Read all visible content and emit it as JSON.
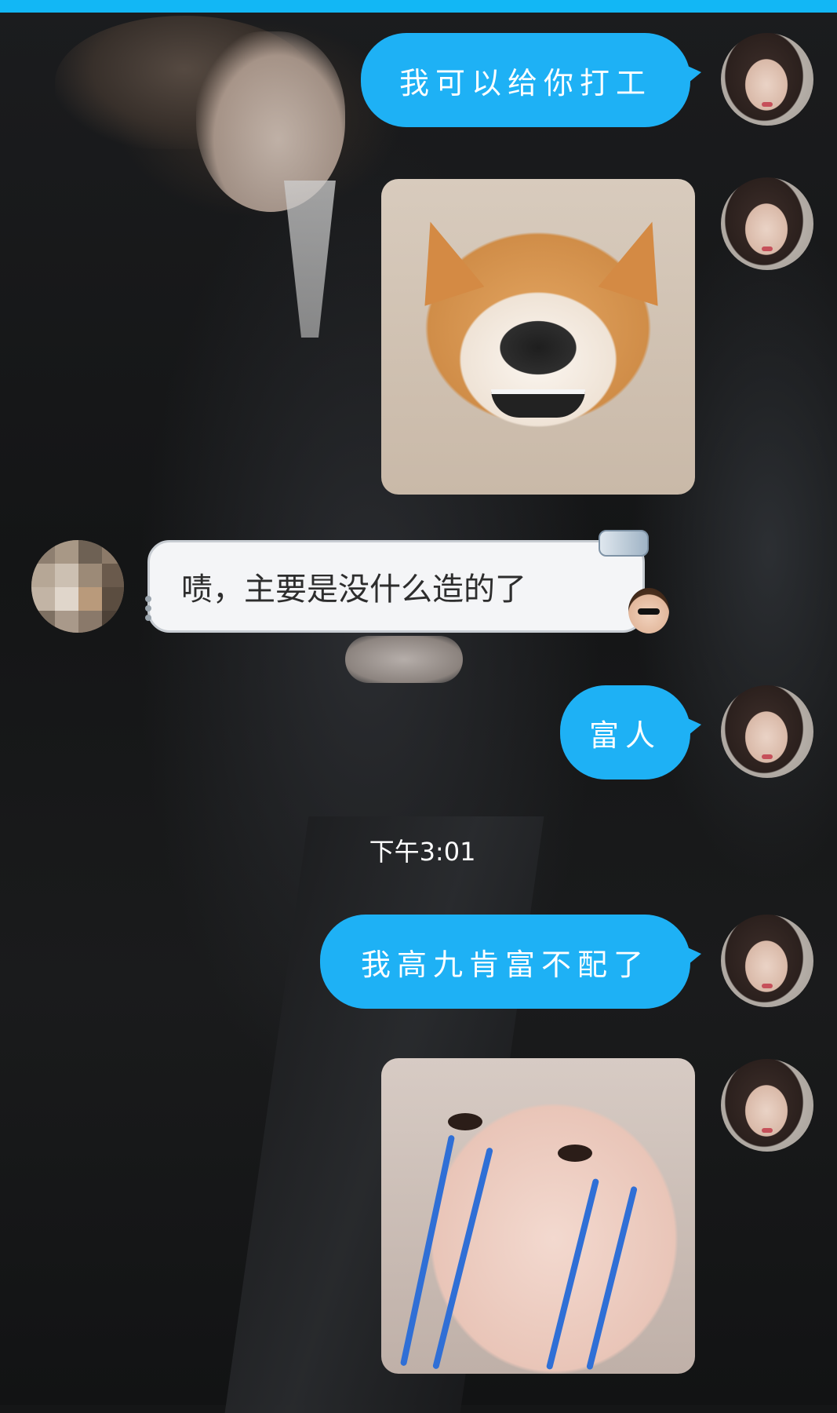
{
  "messages": [
    {
      "side": "right",
      "type": "text",
      "text": "我可以给你打工"
    },
    {
      "side": "right",
      "type": "sticker",
      "sticker": "smiling-shiba-dog"
    },
    {
      "side": "left",
      "type": "text",
      "text": "啧，主要是没什么造的了"
    },
    {
      "side": "right",
      "type": "text",
      "text": "富人"
    },
    {
      "side": "center",
      "type": "timestamp",
      "text": "下午3:01"
    },
    {
      "side": "right",
      "type": "text",
      "text": "我高九肯富不配了"
    },
    {
      "side": "right",
      "type": "sticker",
      "sticker": "crying-baby-face"
    }
  ],
  "colors": {
    "top_bar": "#12b7f5",
    "my_bubble": "#1eb1f5",
    "their_bubble": "#f4f5f7"
  }
}
